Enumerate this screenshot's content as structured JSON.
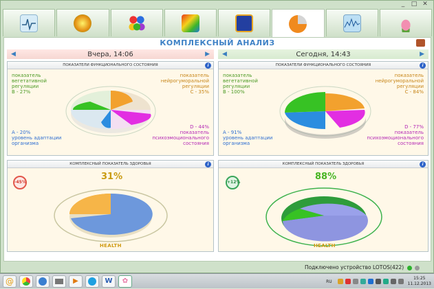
{
  "title": "КОМПЛЕКСНЫЙ АНАЛИЗ",
  "window_controls": [
    "_",
    "□",
    "✕"
  ],
  "toolbar_tabs": [
    {
      "icon": "ecg-icon"
    },
    {
      "icon": "color-circle-icon"
    },
    {
      "icon": "molecule-icon"
    },
    {
      "icon": "body-map-icon"
    },
    {
      "icon": "dragon-icon"
    },
    {
      "icon": "pie-chart-icon",
      "active": true
    },
    {
      "icon": "waveform-icon"
    },
    {
      "icon": "lotus-icon"
    }
  ],
  "left": {
    "day": "Вчера, 14:06",
    "func_title": "ПОКАЗАТЕЛИ ФУНКЦИОНАЛЬНОГО СОСТОЯНИЯ",
    "b_label": "показатель вегетативной регуляции",
    "b_value": "B - 27%",
    "c_label": "показатель нейрогуморальной регуляции",
    "c_value": "C - 35%",
    "a_value": "A - 20%",
    "a_label": "уровень адаптации организма",
    "d_value": "D - 44%",
    "d_label": "показатель психоэмоционального состояния",
    "health_title": "КОМПЛЕКСНЫЙ ПОКАЗАТЕЛЬ ЗДОРОВЬЯ",
    "badge": "-45%",
    "health_pct": "31%",
    "health_label": "HEALTH"
  },
  "right": {
    "day": "Сегодня, 14:43",
    "func_title": "ПОКАЗАТЕЛИ ФУНКЦИОНАЛЬНОГО СОСТОЯНИЯ",
    "b_label": "показатель вегетативной регуляции",
    "b_value": "B - 100%",
    "c_label": "показатель нейрогуморальной регуляции",
    "c_value": "C - 84%",
    "a_value": "A - 91%",
    "a_label": "уровень адаптации организма",
    "d_value": "D - 77%",
    "d_label": "показатель психоэмоционального состояния",
    "health_title": "КОМПЛЕКСНЫЙ ПОКАЗАТЕЛЬ ЗДОРОВЬЯ",
    "badge": "+12%",
    "health_pct": "88%",
    "health_label": "HEALTH"
  },
  "status": "Подключено устройство LOTOS(422)",
  "taskbar": {
    "apps": [
      "skype-mail-icon",
      "chrome-icon",
      "globe-icon",
      "scanner-icon",
      "media-player-icon",
      "skype-icon",
      "word-icon",
      "lotus-app-icon"
    ],
    "lang": "RU",
    "time": "15:25",
    "date": "11.12.2013"
  },
  "colors": {
    "green": "#37c224",
    "orange": "#f2a12e",
    "blue": "#2b8de0",
    "magenta": "#e22ee2",
    "accent": "#3f82c6"
  }
}
